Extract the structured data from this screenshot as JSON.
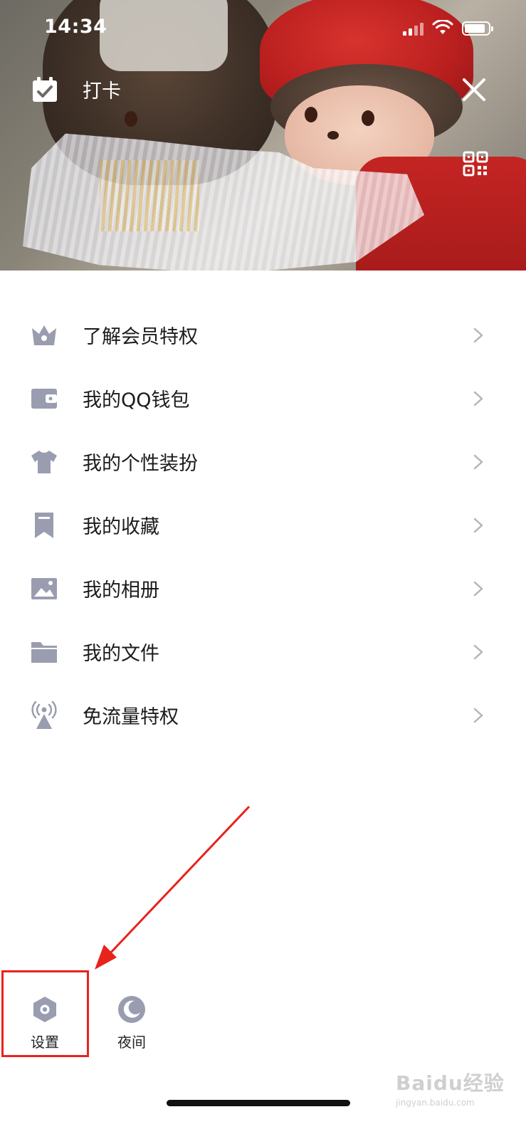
{
  "status_bar": {
    "time": "14:34"
  },
  "header": {
    "checkin_label": "打卡",
    "icons": {
      "checkin": "calendar-check-icon",
      "close": "close-icon",
      "qr": "qr-code-icon"
    }
  },
  "menu": {
    "items": [
      {
        "label": "了解会员特权",
        "icon": "crown-icon"
      },
      {
        "label": "我的QQ钱包",
        "icon": "wallet-icon"
      },
      {
        "label": "我的个性装扮",
        "icon": "tshirt-icon"
      },
      {
        "label": "我的收藏",
        "icon": "bookmark-icon"
      },
      {
        "label": "我的相册",
        "icon": "image-icon"
      },
      {
        "label": "我的文件",
        "icon": "folder-icon"
      },
      {
        "label": "免流量特权",
        "icon": "signal-tower-icon"
      }
    ],
    "icon_color": "#9a9db0"
  },
  "bottom_bar": {
    "settings_label": "设置",
    "night_label": "夜间"
  },
  "annotation": {
    "color": "#e8231c"
  },
  "watermark": {
    "brand": "Baidu经验",
    "url": "jingyan.baidu.com"
  }
}
